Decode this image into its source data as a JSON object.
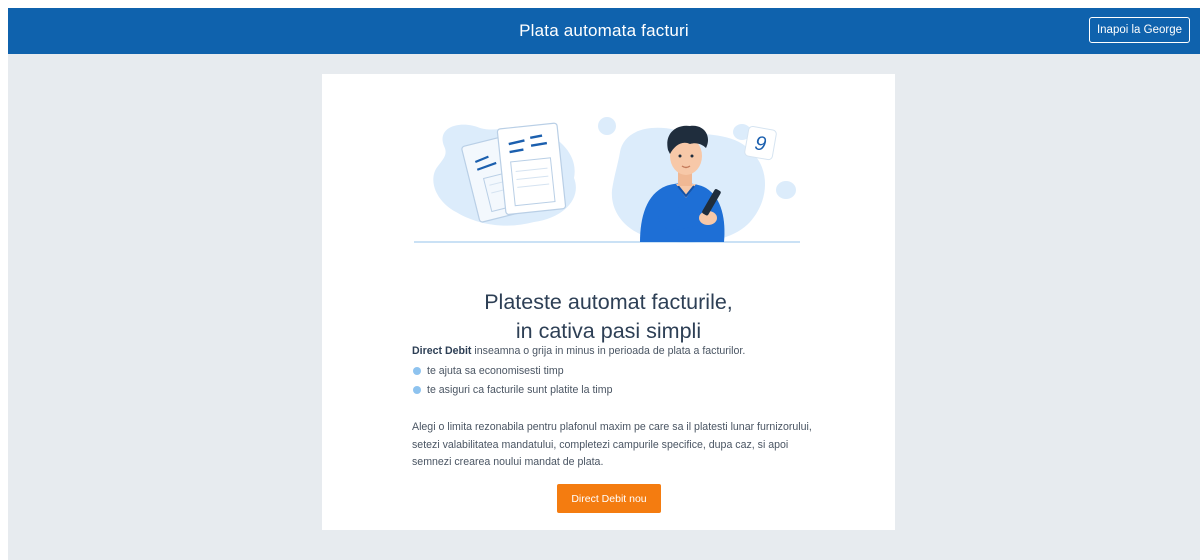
{
  "header": {
    "title": "Plata automata facturi",
    "back_button": "Inapoi la George"
  },
  "illustration": {
    "name": "man-with-phone-and-bills",
    "accent_color": "#1b5fae",
    "shirt_color": "#1e6fd6",
    "blob_color": "#dcecfb",
    "badge_glyph": "9"
  },
  "main": {
    "headline_line1": "Plateste automat facturile,",
    "headline_line2": "in cativa pasi simpli",
    "intro_strong": "Direct Debit",
    "intro_rest": " inseamna o grija in minus in perioada de plata a facturilor.",
    "bullets": [
      "te ajuta sa economisesti timp",
      "te asiguri ca facturile sunt platite la timp"
    ],
    "description": "Alegi o limita rezonabila pentru plafonul maxim pe care sa il platesti lunar furnizorului, setezi valabilitatea mandatului, completezi campurile specifice, dupa caz, si apoi semnezi crearea noului mandat de plata.",
    "cta_label": "Direct Debit nou"
  },
  "colors": {
    "brand_blue": "#0f62ad",
    "page_bg": "#e7ebef",
    "cta_orange": "#f47c10",
    "bullet_dot": "#8ec3ef"
  }
}
